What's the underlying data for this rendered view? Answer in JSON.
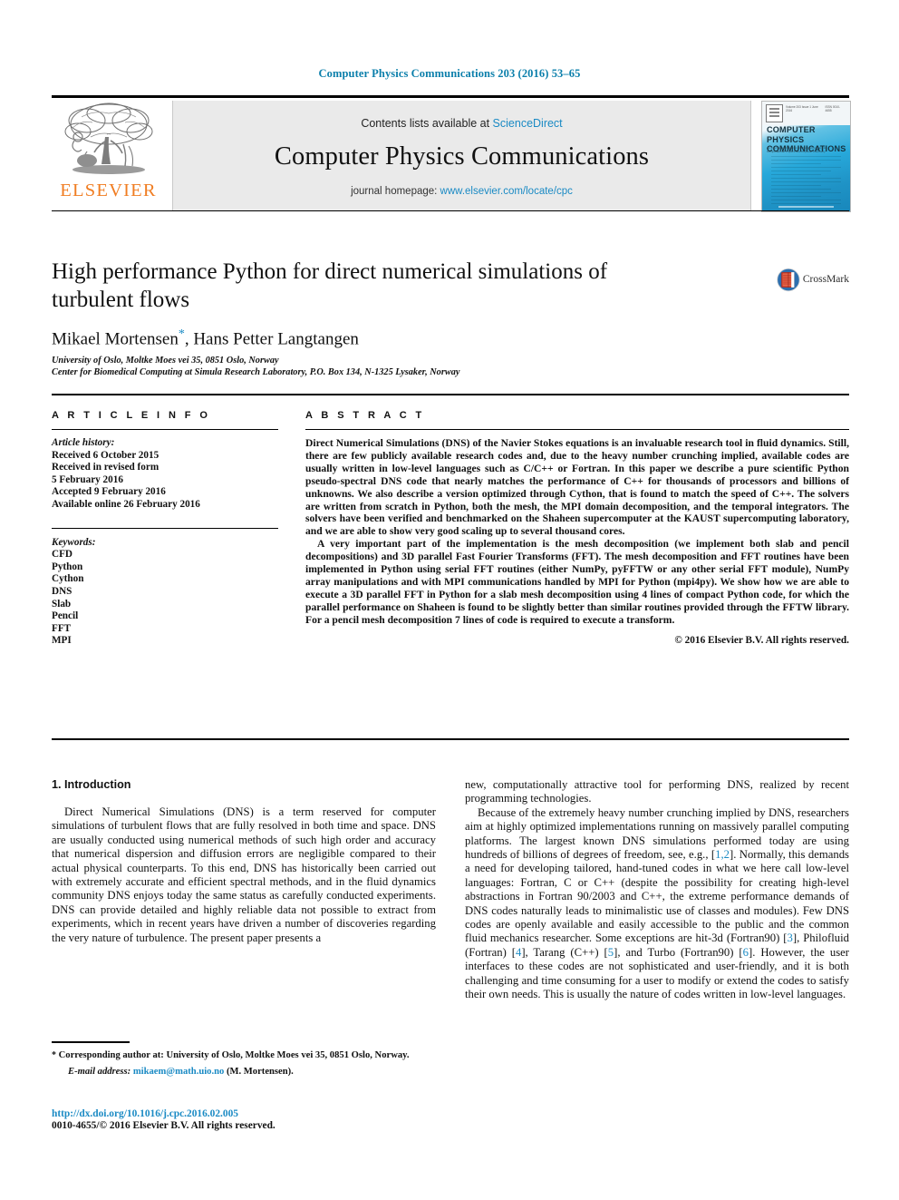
{
  "running_head": "Computer Physics Communications 203 (2016) 53–65",
  "masthead": {
    "publisher_name": "ELSEVIER",
    "contents_prefix": "Contents lists available at ",
    "contents_link": "ScienceDirect",
    "journal_title": "Computer Physics Communications",
    "homepage_prefix": "journal homepage: ",
    "homepage_url": "www.elsevier.com/locate/cpc",
    "cover": {
      "title_line1": "COMPUTER PHYSICS",
      "title_line2": "COMMUNICATIONS",
      "volume_label": "Volume 203 Issue 1 June 2016",
      "issue_label": "ISSN 0010-4655",
      "subtitle": "An International Journal and Program Library for Computational Physics and Physical Chemistry"
    }
  },
  "article": {
    "title": "High performance Python for direct numerical simulations of turbulent flows",
    "authors": "Mikael Mortensen",
    "corresponding_marker": "*",
    "authors_rest": ", Hans Petter Langtangen",
    "affiliation_1": "University of Oslo, Moltke Moes vei 35, 0851 Oslo, Norway",
    "affiliation_2": "Center for Biomedical Computing at Simula Research Laboratory, P.O. Box 134, N-1325 Lysaker, Norway",
    "crossmark_label": "CrossMark"
  },
  "info": {
    "heading": "A R T I C L E    I N F O",
    "history_label": "Article history:",
    "history": [
      "Received 6 October 2015",
      "Received in revised form",
      "5 February 2016",
      "Accepted 9 February 2016",
      "Available online 26 February 2016"
    ],
    "keywords_label": "Keywords:",
    "keywords": [
      "CFD",
      "Python",
      "Cython",
      "DNS",
      "Slab",
      "Pencil",
      "FFT",
      "MPI"
    ]
  },
  "abstract": {
    "heading": "A B S T R A C T",
    "paragraph_1": "Direct Numerical Simulations (DNS) of the Navier Stokes equations is an invaluable research tool in fluid dynamics. Still, there are few publicly available research codes and, due to the heavy number crunching implied, available codes are usually written in low-level languages such as C/C++ or Fortran. In this paper we describe a pure scientific Python pseudo-spectral DNS code that nearly matches the performance of C++ for thousands of processors and billions of unknowns. We also describe a version optimized through Cython, that is found to match the speed of C++. The solvers are written from scratch in Python, both the mesh, the MPI domain decomposition, and the temporal integrators. The solvers have been verified and benchmarked on the Shaheen supercomputer at the KAUST supercomputing laboratory, and we are able to show very good scaling up to several thousand cores.",
    "paragraph_2": "A very important part of the implementation is the mesh decomposition (we implement both slab and pencil decompositions) and 3D parallel Fast Fourier Transforms (FFT). The mesh decomposition and FFT routines have been implemented in Python using serial FFT routines (either NumPy, pyFFTW or any other serial FFT module), NumPy array manipulations and with MPI communications handled by MPI for Python (mpi4py). We show how we are able to execute a 3D parallel FFT in Python for a slab mesh decomposition using 4 lines of compact Python code, for which the parallel performance on Shaheen is found to be slightly better than similar routines provided through the FFTW library. For a pencil mesh decomposition 7 lines of code is required to execute a transform.",
    "copyright": "© 2016 Elsevier B.V. All rights reserved."
  },
  "body": {
    "section_heading": "1. Introduction",
    "left_paragraph": "Direct Numerical Simulations (DNS) is a term reserved for computer simulations of turbulent flows that are fully resolved in both time and space. DNS are usually conducted using numerical methods of such high order and accuracy that numerical dispersion and diffusion errors are negligible compared to their actual physical counterparts. To this end, DNS has historically been carried out with extremely accurate and efficient spectral methods, and in the fluid dynamics community DNS enjoys today the same status as carefully conducted experiments. DNS can provide detailed and highly reliable data not possible to extract from experiments, which in recent years have driven a number of discoveries regarding the very nature of turbulence. The present paper presents a",
    "right_paragraph_1": "new, computationally attractive tool for performing DNS, realized by recent programming technologies.",
    "right_paragraph_2_a": "Because of the extremely heavy number crunching implied by DNS, researchers aim at highly optimized implementations running on massively parallel computing platforms. The largest known DNS simulations performed today are using hundreds of billions of degrees of freedom, see, e.g., [",
    "ref_1_2": "1,2",
    "right_paragraph_2_b": "]. Normally, this demands a need for developing tailored, hand-tuned codes in what we here call low-level languages: Fortran, C or C++ (despite the possibility for creating high-level abstractions in Fortran 90/2003 and C++, the extreme performance demands of DNS codes naturally leads to minimalistic use of classes and modules). Few DNS codes are openly available and easily accessible to the public and the common fluid mechanics researcher. Some exceptions are hit-3d (Fortran90) [",
    "ref_3": "3",
    "right_paragraph_2_c": "], Philofluid (Fortran) [",
    "ref_4": "4",
    "right_paragraph_2_d": "], Tarang (C++) [",
    "ref_5": "5",
    "right_paragraph_2_e": "], and Turbo (Fortran90) [",
    "ref_6": "6",
    "right_paragraph_2_f": "]. However, the user interfaces to these codes are not sophisticated and user-friendly, and it is both challenging and time consuming for a user to modify or extend the codes to satisfy their own needs. This is usually the nature of codes written in low-level languages."
  },
  "footer": {
    "corresponding_marker": "*",
    "corresponding_note": " Corresponding author at: University of Oslo, Moltke Moes vei 35, 0851 Oslo, Norway.",
    "email_label": "E-mail address:",
    "email": "mikaem@math.uio.no",
    "email_owner": "(M. Mortensen).",
    "doi": "http://dx.doi.org/10.1016/j.cpc.2016.02.005",
    "issn_line": "0010-4655/© 2016 Elsevier B.V. All rights reserved."
  },
  "colors": {
    "link_blue": "#1a8ac4",
    "header_blue": "#0b7fab",
    "elsevier_orange": "#f07d22"
  }
}
